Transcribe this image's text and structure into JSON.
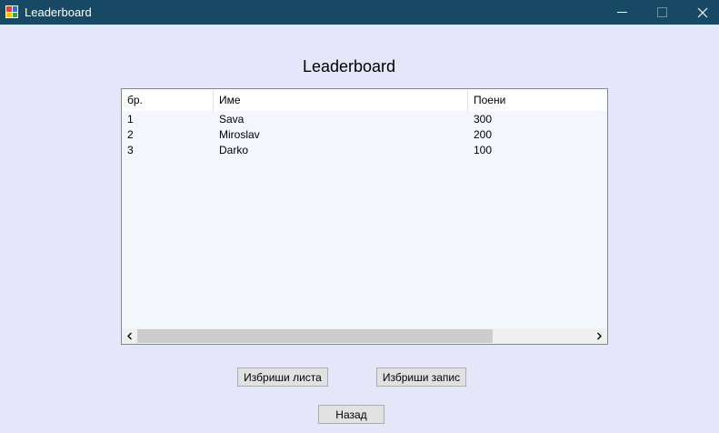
{
  "window": {
    "title": "Leaderboard",
    "colors": {
      "titlebar": "#174864",
      "background": "#e6e6fa"
    }
  },
  "app_icon": {
    "name": "app-form-icon",
    "colors": [
      "#e8412c",
      "#2e6fd8",
      "#f5c400",
      "#3fa142"
    ]
  },
  "heading": "Leaderboard",
  "listview": {
    "columns": [
      "бр.",
      "Име",
      "Поени"
    ],
    "rows": [
      {
        "rank": "1",
        "name": "Sava",
        "points": "300"
      },
      {
        "rank": "2",
        "name": "Miroslav",
        "points": "200"
      },
      {
        "rank": "3",
        "name": "Darko",
        "points": "100"
      }
    ]
  },
  "buttons": {
    "clear_list": "Избриши листа",
    "delete_entry": "Избриши запис",
    "back": "Назад"
  }
}
